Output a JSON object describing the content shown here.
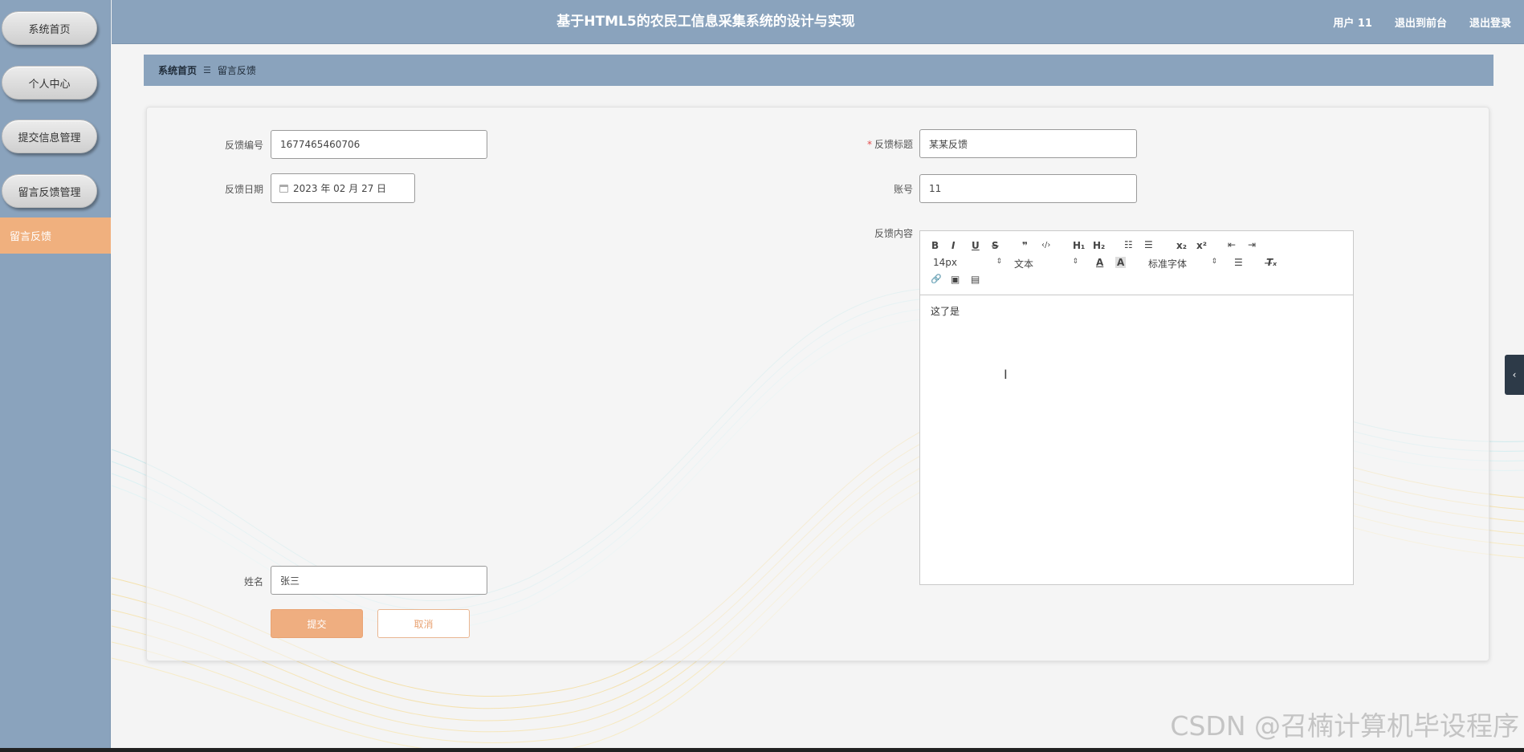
{
  "sidebar": {
    "items": [
      {
        "label": "系统首页"
      },
      {
        "label": "个人中心"
      },
      {
        "label": "提交信息管理"
      },
      {
        "label": "留言反馈管理"
      }
    ],
    "sub_item": {
      "label": "留言反馈"
    }
  },
  "header": {
    "title": "基于HTML5的农民工信息采集系统的设计与实现",
    "user": "用户 11",
    "back_front": "退出到前台",
    "logout": "退出登录"
  },
  "breadcrumb": {
    "home": "系统首页",
    "separator": "☰",
    "current": "留言反馈"
  },
  "form": {
    "feedback_no_label": "反馈编号",
    "feedback_no_value": "1677465460706",
    "feedback_date_label": "反馈日期",
    "feedback_date_value": "2023 年 02 月 27 日",
    "required_mark": "*",
    "title_label": "反馈标题",
    "title_value": "某某反馈",
    "account_label": "账号",
    "account_value": "11",
    "content_label": "反馈内容",
    "content_value": "这了是",
    "name_label": "姓名",
    "name_value": "张三",
    "submit_label": "提交",
    "cancel_label": "取消"
  },
  "editor": {
    "bold": "B",
    "italic": "I",
    "underline": "U",
    "strike": "S",
    "quote": "❞",
    "code": "‹/›",
    "h1": "H₁",
    "h2": "H₂",
    "ordered_list": "☷",
    "bullet_list": "☰",
    "subscript": "x₂",
    "superscript": "x²",
    "outdent": "⇤",
    "indent": "⇥",
    "size": "14px",
    "format": "文本",
    "font_color": "A",
    "bg_color": "A",
    "font_family": "标准字体",
    "align": "☰",
    "clean": "T̶ₓ",
    "link": "🔗",
    "image": "▣",
    "video": "▤",
    "select_arrow": "⇕"
  },
  "side_tab": {
    "label": "‹"
  },
  "watermark": "CSDN @召楠计算机毕设程序"
}
